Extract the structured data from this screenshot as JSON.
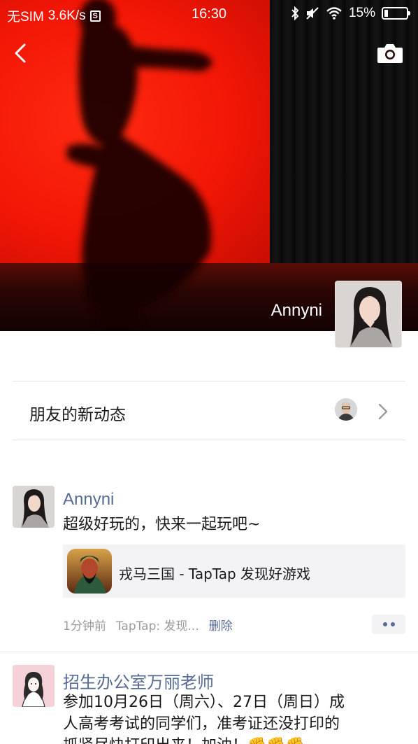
{
  "status_bar": {
    "carrier": "无SIM",
    "speed": "3.6K/s",
    "sim_badge": "S",
    "time": "16:30",
    "battery": "15%"
  },
  "profile": {
    "name": "Annyni"
  },
  "friends_updates": {
    "label": "朋友的新动态"
  },
  "posts": [
    {
      "author": "Annyni",
      "text": "超级好玩的，快来一起玩吧~",
      "share_title": "戎马三国 - TapTap 发现好游戏",
      "time": "1分钟前",
      "source": "TapTap: 发现...",
      "delete_label": "删除"
    },
    {
      "author": "招生办公室万丽老师",
      "text_lines": [
        "参加10月26日（周六）、27日（周日）成",
        "人高考考试的同学们，准考证还没打印的",
        "抓紧尽快打印出来！加油！✊✊✊"
      ]
    }
  ],
  "colors": {
    "link_blue": "#576b95",
    "cover_red": "#f21606"
  },
  "icons": {
    "back": "chevron-left-icon",
    "camera": "camera-icon",
    "bluetooth": "bluetooth-icon",
    "mute": "mute-icon",
    "wifi": "wifi-icon",
    "battery": "battery-icon",
    "more": "more-dots-icon",
    "chevron": "chevron-right-icon"
  }
}
